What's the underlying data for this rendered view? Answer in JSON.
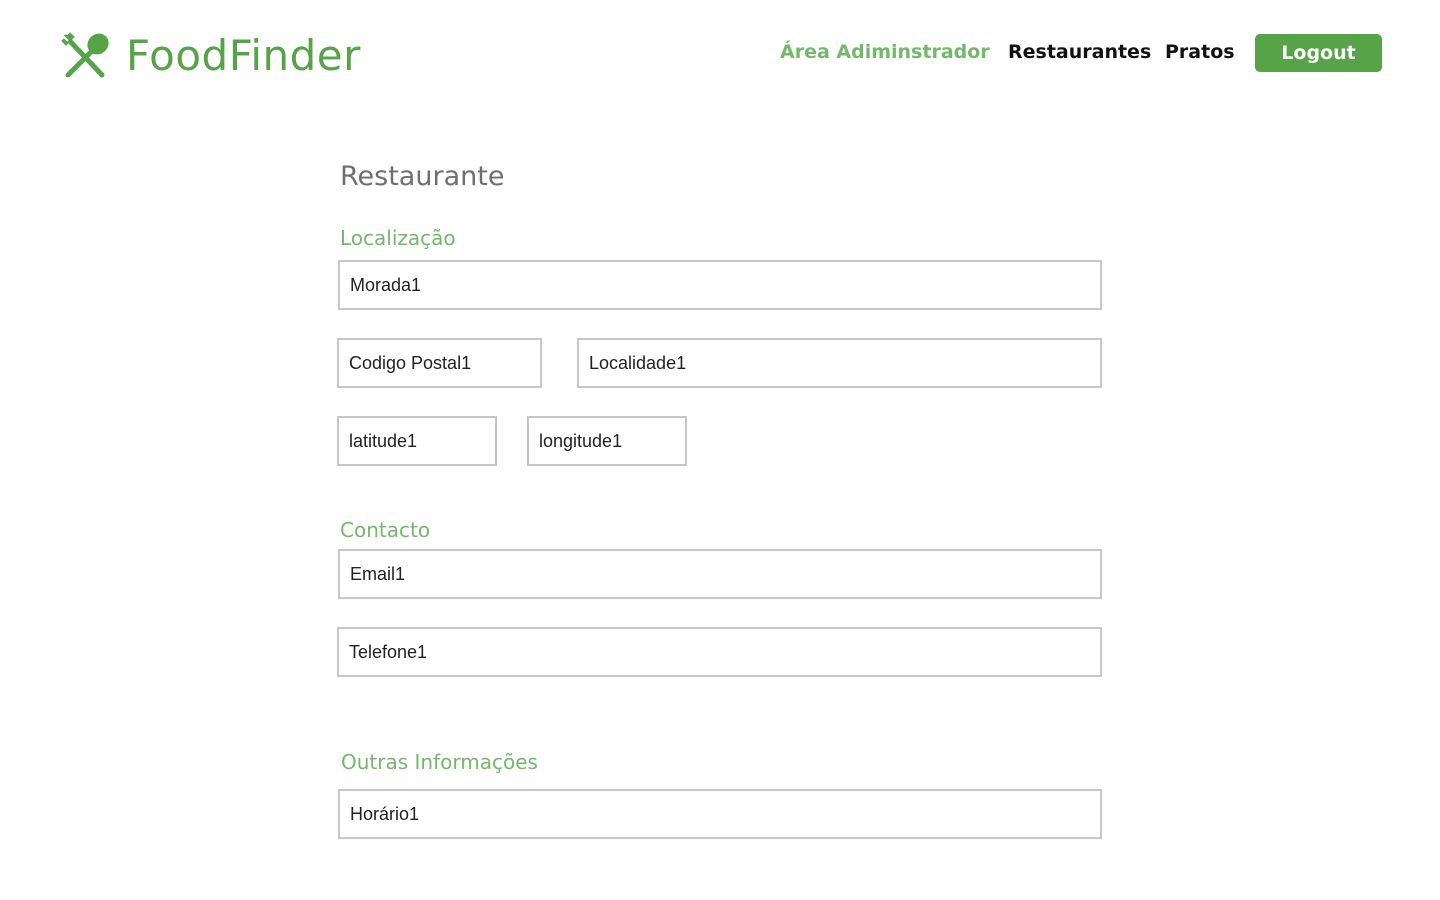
{
  "brand": {
    "name": "FoodFinder",
    "color": "#56a348",
    "icon": "fork-spoon-icon"
  },
  "nav": {
    "admin_area": "Área Adiminstrador",
    "restaurants": "Restaurantes",
    "dishes": "Pratos",
    "logout": "Logout"
  },
  "form": {
    "title": "Restaurante",
    "sections": {
      "location": "Localização",
      "contact": "Contacto",
      "other_info": "Outras Informações"
    },
    "fields": {
      "address": "Morada1",
      "postal_code": "Codigo Postal1",
      "locality": "Localidade1",
      "latitude": "latitude1",
      "longitude": "longitude1",
      "email": "Email1",
      "phone": "Telefone1",
      "schedule": "Horário1"
    }
  },
  "colors": {
    "accent": "#56a348",
    "accent_light": "#74b96b",
    "title": "#6f6f6f",
    "field_border": "#c8c8c8"
  }
}
